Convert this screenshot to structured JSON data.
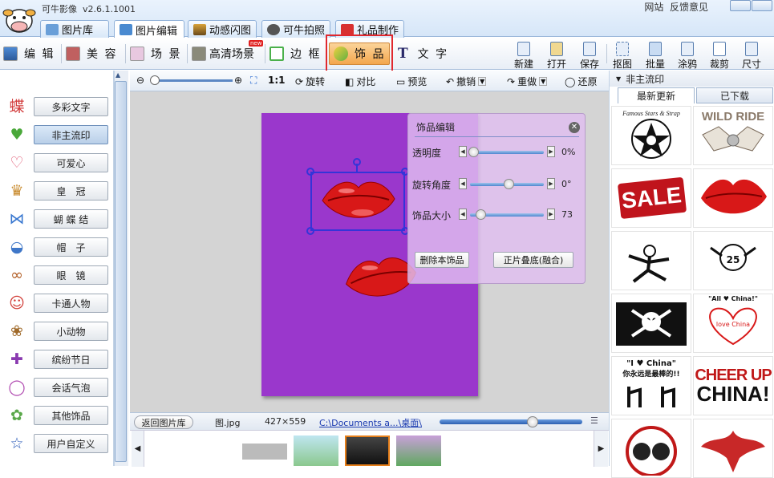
{
  "app": {
    "title": "可牛影像",
    "version": "v2.6.1.1001",
    "links": [
      "网站",
      "反馈意见"
    ]
  },
  "main_tabs": [
    {
      "label": "图片库",
      "icon": "gallery-icon"
    },
    {
      "label": "图片编辑",
      "icon": "edit-icon",
      "active": true
    },
    {
      "label": "动感闪图",
      "icon": "flash-icon"
    },
    {
      "label": "可牛拍照",
      "icon": "camera-icon"
    },
    {
      "label": "礼品制作",
      "icon": "gift-icon"
    }
  ],
  "toolbar": {
    "edit": "编 辑",
    "beauty": "美 容",
    "scene": "场 景",
    "hd_scene": "高清场景",
    "hd_badge": "new",
    "frame": "边 框",
    "decor": "饰 品",
    "text": "文 字",
    "actions": [
      "新建",
      "打开",
      "保存",
      "抠图",
      "批量",
      "涂鸦",
      "裁剪",
      "尺寸"
    ]
  },
  "categories": [
    {
      "label": "多彩文字",
      "icon": "colorful-text-icon",
      "glyph": "蝶",
      "color": "#d23b3b"
    },
    {
      "label": "非主流印",
      "icon": "heart-stamp-icon",
      "glyph": "♥",
      "color": "#4aa83a",
      "selected": true
    },
    {
      "label": "可爱心",
      "icon": "heart-outline-icon",
      "glyph": "♡",
      "color": "#e05570"
    },
    {
      "label": "皇　冠",
      "icon": "crown-icon",
      "glyph": "♛",
      "color": "#c88a2c"
    },
    {
      "label": "蝴 蝶 结",
      "icon": "bow-icon",
      "glyph": "⋈",
      "color": "#3a78d0"
    },
    {
      "label": "帽　子",
      "icon": "hat-icon",
      "glyph": "◒",
      "color": "#3f77c8"
    },
    {
      "label": "眼　镜",
      "icon": "glasses-icon",
      "glyph": "∞",
      "color": "#b05a20"
    },
    {
      "label": "卡通人物",
      "icon": "cartoon-icon",
      "glyph": "☺",
      "color": "#d2403a"
    },
    {
      "label": "小动物",
      "icon": "animal-icon",
      "glyph": "❀",
      "color": "#a06a2a"
    },
    {
      "label": "缤纷节日",
      "icon": "festival-gift-icon",
      "glyph": "✚",
      "color": "#8a3ab0"
    },
    {
      "label": "会话气泡",
      "icon": "speech-bubble-icon",
      "glyph": "◯",
      "color": "#b04ab0"
    },
    {
      "label": "其他饰品",
      "icon": "other-decor-icon",
      "glyph": "✿",
      "color": "#5aa84a"
    },
    {
      "label": "用户自定义",
      "icon": "star-outline-icon",
      "glyph": "☆",
      "color": "#2a5ab8"
    }
  ],
  "edit_tools": {
    "zoom_ratio": "1:1",
    "zoom_level": 0.03,
    "rotate": "旋转",
    "contrast": "对比",
    "preview": "预览",
    "undo": "撤销",
    "redo": "重做",
    "restore": "还原"
  },
  "decor_dialog": {
    "title": "饰品编辑",
    "sliders": [
      {
        "label": "透明度",
        "value": "0%",
        "level": 0.0
      },
      {
        "label": "旋转角度",
        "value": "0°",
        "level": 0.5
      },
      {
        "label": "饰品大小",
        "value": "73",
        "level": 0.1
      }
    ],
    "delete_button": "删除本饰品",
    "blend_button": "正片叠底(融合)"
  },
  "status": {
    "back": "返回图片库",
    "filename": "图.jpg",
    "dimensions": "427×559",
    "path": "C:\\Documents a...\\桌面\\",
    "slider_level": 0.65
  },
  "right_panel": {
    "title": "非主流印",
    "tabs": [
      "最新更新",
      "已下载"
    ],
    "items": [
      {
        "name": "famous-stars-stamp",
        "text": "Famous Stars & Strap"
      },
      {
        "name": "wild-ride-stamp",
        "text": "WILD RIDE"
      },
      {
        "name": "sale-stamp",
        "text": "SALE"
      },
      {
        "name": "lips-stamp",
        "text": ""
      },
      {
        "name": "fighter-stamp",
        "text": ""
      },
      {
        "name": "skull-25-stamp",
        "text": "25"
      },
      {
        "name": "pirate-flag-stamp",
        "text": ""
      },
      {
        "name": "love-china-hearts-stamp",
        "text": "\"All ♥ China!\""
      },
      {
        "name": "i-love-china-stamp",
        "text": "\"I ♥ China\"",
        "subtext": "你永远是最棒的!!"
      },
      {
        "name": "cheer-up-china-stamp",
        "text": "CHEER UP",
        "subtext": "CHINA!"
      },
      {
        "name": "skulls-stamp",
        "text": ""
      },
      {
        "name": "eagle-stamp",
        "text": ""
      }
    ]
  },
  "colors": {
    "photo_bg": "#9a37cc",
    "selection": "#3434d8",
    "highlight_box": "#e0282e",
    "dialog_bg": "#e1bef0"
  }
}
